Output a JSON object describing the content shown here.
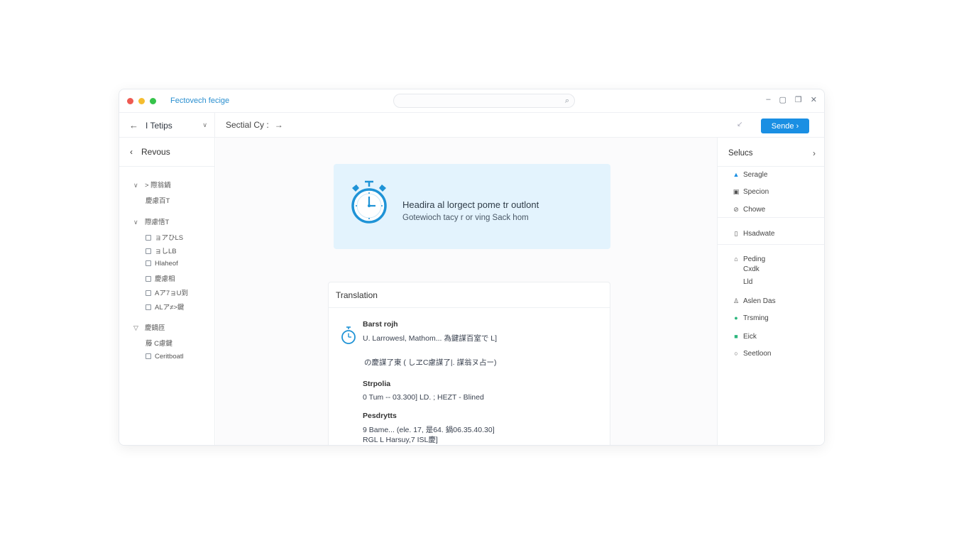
{
  "window": {
    "title": "Fectovech fecige",
    "controls": [
      "–",
      "▢",
      "❐",
      "✕"
    ],
    "traffic_lights": [
      "#ee5a52",
      "#f5bd2f",
      "#35c34a"
    ]
  },
  "toolbar": {
    "left_label": "I Tetips",
    "breadcrumb": "Sectial Cy :",
    "small_mark": "↙",
    "primary_button": "Sende ›",
    "accent": "#1a8fe3"
  },
  "sidebar": {
    "header": "Revous",
    "tree": [
      {
        "type": "group",
        "caret": "∨",
        "label": "> 際翁鍋"
      },
      {
        "type": "plain",
        "label": "慶慮百T"
      },
      {
        "type": "group",
        "caret": "∨",
        "label": "際慮悟T"
      },
      {
        "type": "check",
        "label": "ョアひLS"
      },
      {
        "type": "check",
        "label": "ョしLB"
      },
      {
        "type": "check",
        "label": "Hlaheof"
      },
      {
        "type": "check",
        "label": "慶慮相"
      },
      {
        "type": "check",
        "label": "Aア7ョU到"
      },
      {
        "type": "check",
        "label": "ALア≠>鍵"
      },
      {
        "type": "group",
        "caret": "▽",
        "label": "慶鍋匝"
      },
      {
        "type": "plain",
        "label": "藤 C慮鍵"
      },
      {
        "type": "check",
        "label": "Ceritboatl"
      }
    ]
  },
  "banner": {
    "title": "Headira al lorgect pome tr outlont",
    "subtitle": "Gotewioch tacy r or ving Sack hom",
    "bg": "#e3f3fd",
    "icon": "stopwatch-icon"
  },
  "card": {
    "header": "Translation",
    "heading1": "Barst rojh",
    "line1": "U. Larrowesl, Mathom... 為鍵謀百室で L]",
    "line2": "の慶謀了東 ( しヱC慮謀了|. 謀翁ヌ占ー)",
    "heading2": "Strpolia",
    "line3": "0 Tum -- 03.300] LD. ; HEZT - Blined",
    "heading3": "Pesdrytts",
    "line4": "9 Bame... (ele. 17, 是64. 鍋06.35.40.30]",
    "line5": "RGL L Harsuy,7 ISL慶]"
  },
  "right_panel": {
    "header": "Selucs",
    "items": [
      {
        "icon": "person-icon",
        "glyph": "▲",
        "color": "#1a8fe3",
        "label": "Seragle"
      },
      {
        "icon": "document-icon",
        "glyph": "▣",
        "color": "#555555",
        "label": "Specion"
      },
      {
        "icon": "link-icon",
        "glyph": "⊘",
        "color": "#555555",
        "label": "Chowe"
      },
      {
        "icon": "clipboard-icon",
        "glyph": "▯",
        "color": "#555555",
        "label": "Hsadwate"
      },
      {
        "icon": "drop-icon",
        "glyph": "⌂",
        "color": "#555555",
        "label": "Peding"
      },
      {
        "icon": "none",
        "glyph": "",
        "color": "#555555",
        "label": "Cxdk"
      },
      {
        "icon": "none",
        "glyph": "",
        "color": "#555555",
        "label": "Lld"
      },
      {
        "icon": "person-outline-icon",
        "glyph": "♙",
        "color": "#555555",
        "label": "Aslen Das"
      },
      {
        "icon": "status-dot-icon",
        "glyph": "●",
        "color": "#2cb67d",
        "label": "Trsming"
      },
      {
        "icon": "folder-icon",
        "glyph": "■",
        "color": "#2cb67d",
        "label": "Eick"
      },
      {
        "icon": "circle-icon",
        "glyph": "○",
        "color": "#555555",
        "label": "Seetloon"
      }
    ]
  }
}
